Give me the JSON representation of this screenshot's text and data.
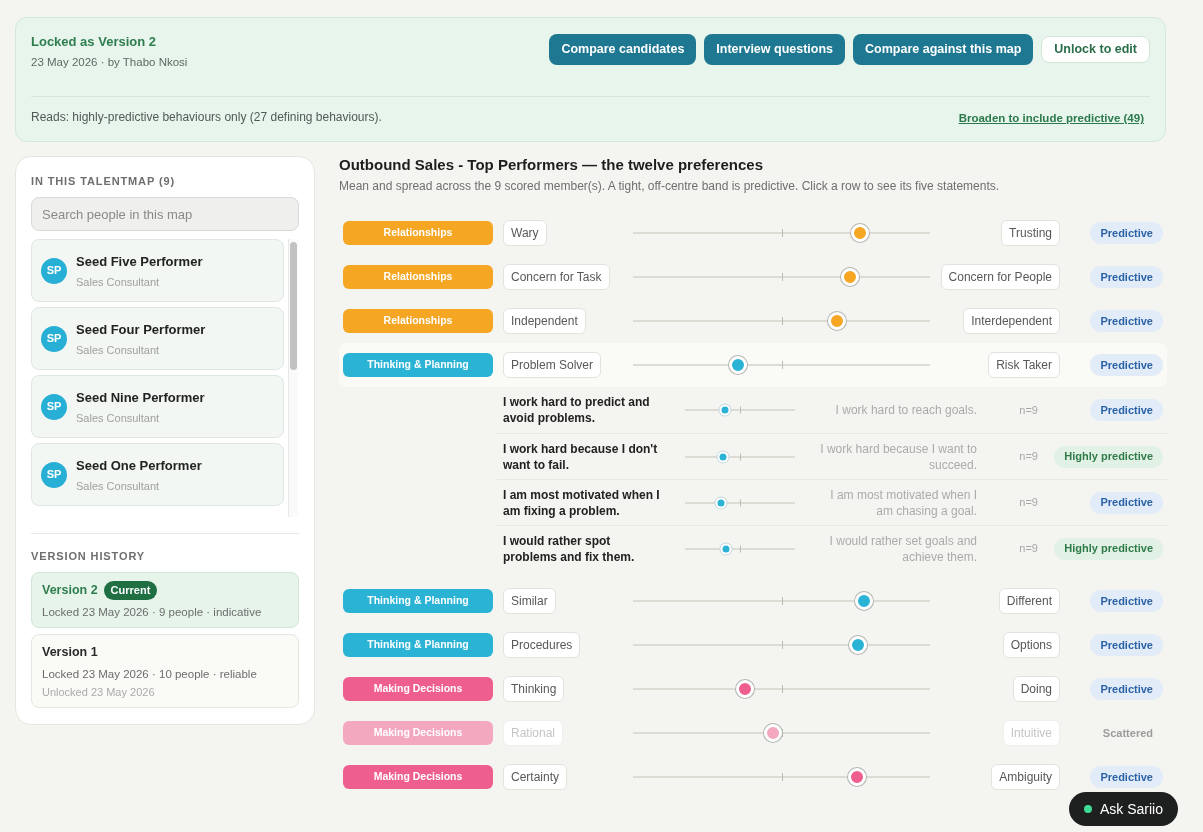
{
  "banner": {
    "title": "Locked as Version 2",
    "subtitle": "23 May 2026 · by Thabo Nkosi",
    "actions": [
      {
        "label": "Compare candidates",
        "kind": "primary"
      },
      {
        "label": "Interview questions",
        "kind": "primary"
      },
      {
        "label": "Compare against this map",
        "kind": "primary"
      },
      {
        "label": "Unlock to edit",
        "kind": "secondary"
      }
    ],
    "note": "Reads: highly-predictive behaviours only (27 defining behaviours).",
    "link": "Broaden to include predictive (49)"
  },
  "sidebar": {
    "members_heading": "IN THIS TALENTMAP (9)",
    "search": {
      "placeholder": "Search people in this map"
    },
    "members": [
      {
        "initials": "SP",
        "name": "Seed Five Performer",
        "role": "Sales Consultant"
      },
      {
        "initials": "SP",
        "name": "Seed Four Performer",
        "role": "Sales Consultant"
      },
      {
        "initials": "SP",
        "name": "Seed Nine Performer",
        "role": "Sales Consultant"
      },
      {
        "initials": "SP",
        "name": "Seed One Performer",
        "role": "Sales Consultant"
      }
    ],
    "history_heading": "VERSION HISTORY",
    "versions": [
      {
        "label": "Version 2",
        "badge": "Current",
        "selected": true,
        "details": "Locked 23 May 2026 · 9 people · indicative"
      },
      {
        "label": "Version 1",
        "selected": false,
        "details": "Locked 23 May 2026 · 10 people · reliable",
        "note": "Unlocked 23 May 2026"
      }
    ]
  },
  "preferences": {
    "title": "Outbound Sales - Top Performers — the twelve preferences",
    "subtitle": "Mean and spread across the 9 scored member(s). A tight, off-centre band is predictive. Click a row to see its five statements.",
    "rows": [
      {
        "category": "Relationships",
        "color": "#f5a623",
        "left": "Wary",
        "right": "Trusting",
        "level": 0.764,
        "badge": {
          "label": "Predictive",
          "kind": "predictive"
        }
      },
      {
        "category": "Relationships",
        "color": "#f5a623",
        "left": "Concern for Task",
        "right": "Concern for People",
        "level": 0.73,
        "badge": {
          "label": "Predictive",
          "kind": "predictive"
        }
      },
      {
        "category": "Relationships",
        "color": "#f5a623",
        "left": "Independent",
        "right": "Interdependent",
        "level": 0.687,
        "badge": {
          "label": "Predictive",
          "kind": "predictive"
        }
      },
      {
        "category": "Thinking & Planning",
        "color": "#2bb3d6",
        "left": "Problem Solver",
        "right": "Risk Taker",
        "level": 0.354,
        "badge": {
          "label": "Predictive",
          "kind": "predictive"
        },
        "statements": [
          {
            "left": "I work hard to predict and avoid problems.",
            "right": "I work hard to reach goals.",
            "count": "n=9",
            "level": 0.364,
            "badge": {
              "label": "Predictive",
              "kind": "predictive"
            }
          },
          {
            "left": "I work hard because I don't want to fail.",
            "right": "I work hard because I want to succeed.",
            "count": "n=9",
            "level": 0.345,
            "badge": {
              "label": "Highly predictive",
              "kind": "highly_predictive"
            }
          },
          {
            "left": "I am most motivated when I am fixing a problem.",
            "right": "I am most motivated when I am chasing a goal.",
            "count": "n=9",
            "level": 0.327,
            "badge": {
              "label": "Predictive",
              "kind": "predictive"
            }
          },
          {
            "left": "I would rather spot problems and fix them.",
            "right": "I would rather set goals and achieve them.",
            "count": "n=9",
            "level": 0.373,
            "badge": {
              "label": "Highly predictive",
              "kind": "highly_predictive"
            }
          }
        ]
      },
      {
        "category": "Thinking & Planning",
        "color": "#2bb3d6",
        "left": "Similar",
        "right": "Different",
        "level": 0.778,
        "badge": {
          "label": "Predictive",
          "kind": "predictive"
        }
      },
      {
        "category": "Thinking & Planning",
        "color": "#2bb3d6",
        "left": "Procedures",
        "right": "Options",
        "level": 0.758,
        "badge": {
          "label": "Predictive",
          "kind": "predictive"
        }
      },
      {
        "category": "Making Decisions",
        "color": "#ee5f8f",
        "left": "Thinking",
        "right": "Doing",
        "level": 0.377,
        "badge": {
          "label": "Predictive",
          "kind": "predictive"
        }
      },
      {
        "category": "Making Decisions",
        "color": "#f3a8c0",
        "left": "Rational",
        "right": "Intuitive",
        "level": 0.471,
        "badge": {
          "label": "Scattered",
          "kind": "scattered"
        }
      },
      {
        "category": "Making Decisions",
        "color": "#ee5f8f",
        "left": "Certainty",
        "right": "Ambiguity",
        "level": 0.754,
        "badge": {
          "label": "Predictive",
          "kind": "predictive"
        }
      }
    ]
  },
  "assistant": {
    "label": "Ask Sariio"
  }
}
